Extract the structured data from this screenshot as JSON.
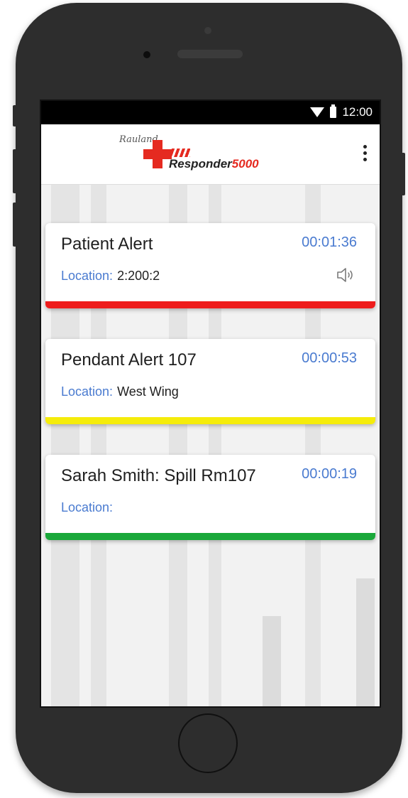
{
  "status_bar": {
    "time": "12:00",
    "wifi_icon": "wifi-icon",
    "battery_icon": "battery-icon"
  },
  "app_bar": {
    "logo": {
      "brand_small": "Rauland",
      "product_name": "Responder",
      "product_number": "5000"
    },
    "menu_icon": "more-vert-icon"
  },
  "colors": {
    "red": "#ee1c1c",
    "yellow": "#f5ec0a",
    "green": "#1aa83a",
    "timer_blue": "#4a7bd0",
    "brand_red": "#e52a20"
  },
  "alerts": [
    {
      "title": "Patient Alert",
      "timer": "00:01:36",
      "location_label": "Location:",
      "location_value": "2:200:2",
      "priority_color": "red",
      "audible": true,
      "sound_icon": "speaker-icon"
    },
    {
      "title": "Pendant Alert 107",
      "timer": "00:00:53",
      "location_label": "Location:",
      "location_value": "West Wing",
      "priority_color": "yellow",
      "audible": false
    },
    {
      "title": "Sarah Smith: Spill Rm107",
      "timer": "00:00:19",
      "location_label": "Location:",
      "location_value": "",
      "priority_color": "green",
      "audible": false
    }
  ]
}
